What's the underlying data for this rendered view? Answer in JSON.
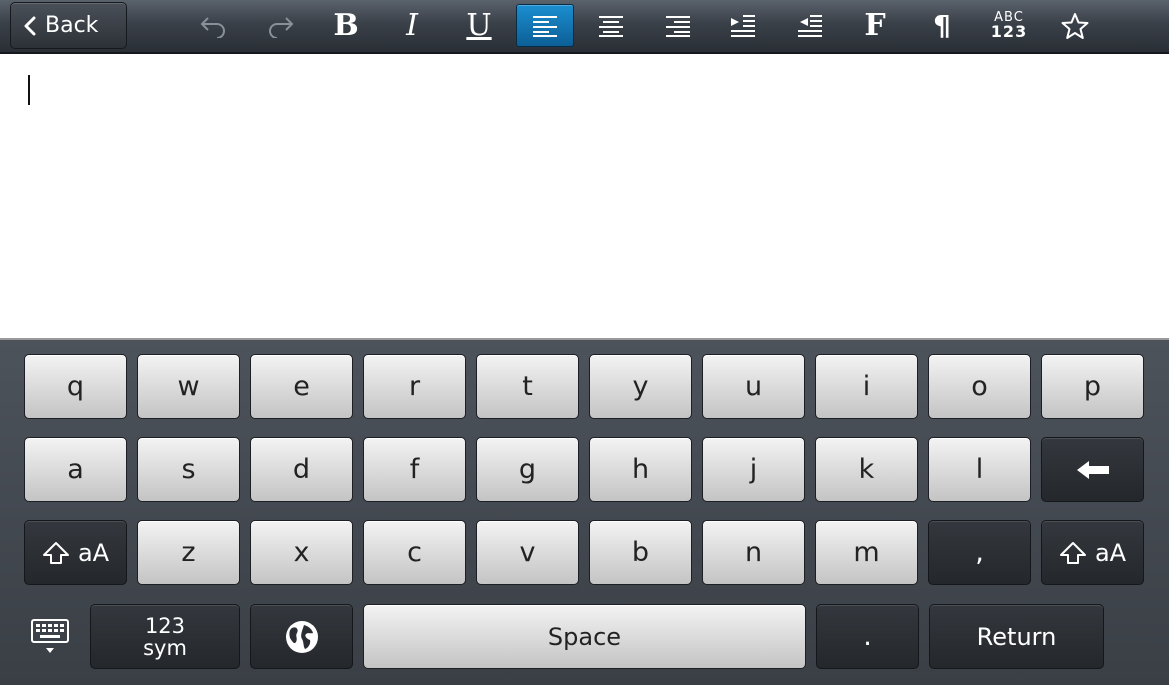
{
  "toolbar": {
    "back_label": "Back",
    "tools": [
      {
        "name": "undo",
        "icon": "undo-icon",
        "enabled": false
      },
      {
        "name": "redo",
        "icon": "redo-icon",
        "enabled": false
      },
      {
        "name": "bold",
        "glyph": "B"
      },
      {
        "name": "italic",
        "glyph": "I"
      },
      {
        "name": "underline",
        "glyph": "U"
      },
      {
        "name": "align-left",
        "icon": "align-left-icon",
        "active": true
      },
      {
        "name": "align-center",
        "icon": "align-center-icon"
      },
      {
        "name": "align-right",
        "icon": "align-right-icon"
      },
      {
        "name": "indent",
        "icon": "indent-icon"
      },
      {
        "name": "outdent",
        "icon": "outdent-icon"
      },
      {
        "name": "font",
        "glyph": "F"
      },
      {
        "name": "paragraph",
        "glyph": "¶"
      },
      {
        "name": "spellcheck",
        "glyph_top": "ABC",
        "glyph_bottom": "123"
      },
      {
        "name": "favorite",
        "icon": "star-icon"
      }
    ],
    "active_color": "#1b8ed0"
  },
  "editor": {
    "text": ""
  },
  "keyboard": {
    "row1": [
      "q",
      "w",
      "e",
      "r",
      "t",
      "y",
      "u",
      "i",
      "o",
      "p"
    ],
    "row2": [
      "a",
      "s",
      "d",
      "f",
      "g",
      "h",
      "j",
      "k",
      "l"
    ],
    "row3": [
      "z",
      "x",
      "c",
      "v",
      "b",
      "n",
      "m",
      ","
    ],
    "shift_label": "aA",
    "sym_top": "123",
    "sym_bottom": "sym",
    "space_label": "Space",
    "period_label": ".",
    "return_label": "Return",
    "hide_keyboard_icon": "keyboard-hide-icon",
    "language_icon": "globe-icon",
    "backspace_icon": "backspace-arrow-icon",
    "shift_icon": "shift-arrow-icon"
  }
}
